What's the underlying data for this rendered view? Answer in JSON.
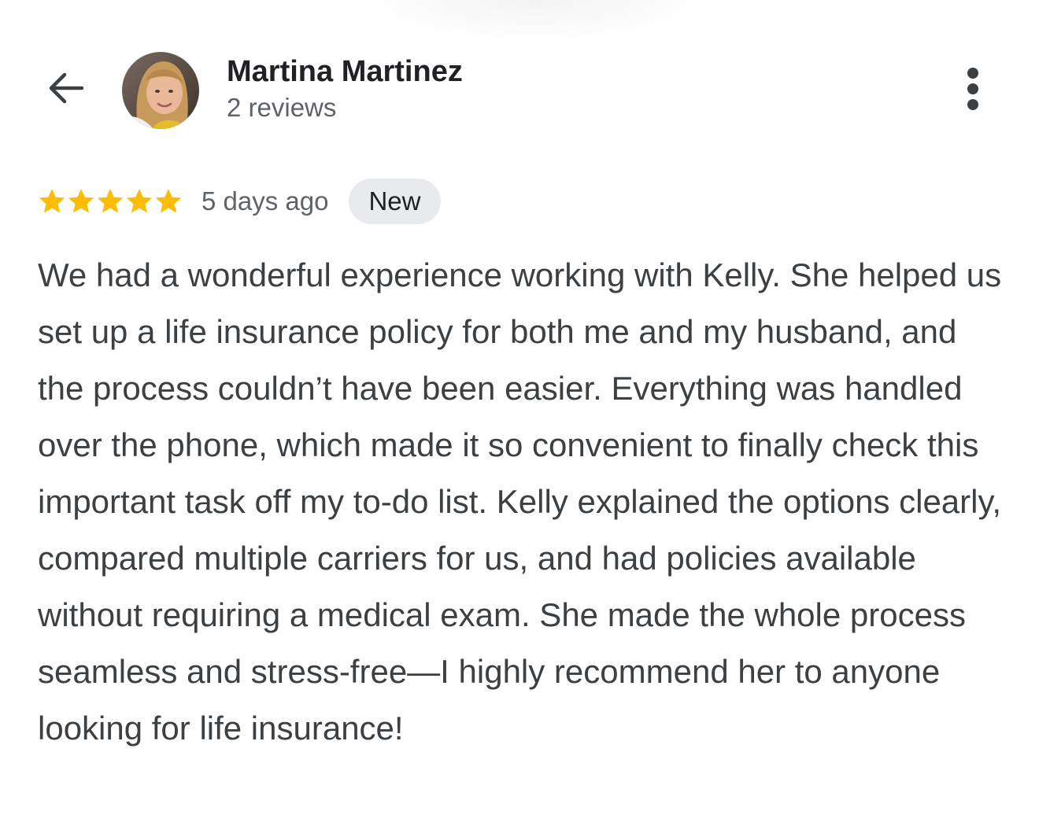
{
  "header": {
    "back_icon": "arrow-back-icon",
    "avatar_icon": "user-avatar-photo",
    "name": "Martina Martinez",
    "reviews_count": "2 reviews",
    "more_icon": "more-vert-icon"
  },
  "review": {
    "rating": 5,
    "rating_max": 5,
    "star_color": "#fbbc04",
    "date": "5 days ago",
    "badge": "New",
    "text": "We had a wonderful experience working with Kelly. She helped us set up a life insurance policy for both me and my husband, and the process couldn’t have been easier. Everything was handled over the phone, which made it so convenient to finally check this important task off my to-do list. Kelly explained the options clearly, compared multiple carriers for us, and had policies available without requiring a medical exam. She made the whole process seamless and stress-free—I highly recommend her to anyone looking for life insurance!"
  }
}
